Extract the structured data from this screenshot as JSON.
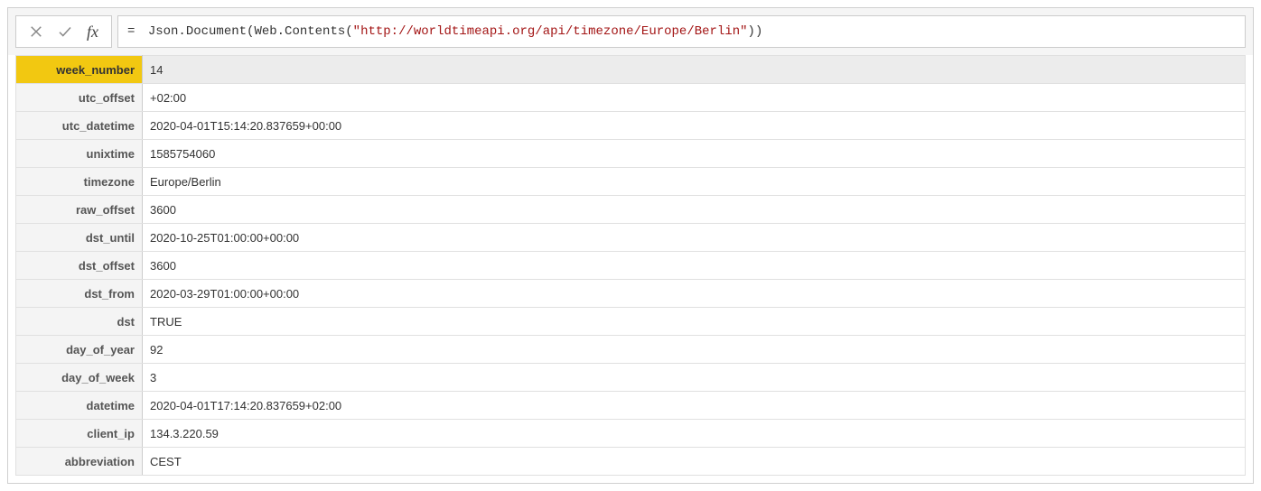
{
  "formula": {
    "prefix": "= ",
    "fn1": "Json.Document",
    "fn2": "Web.Contents",
    "url": "\"http://worldtimeapi.org/api/timezone/Europe/Berlin\""
  },
  "rows": [
    {
      "key": "week_number",
      "value": "14",
      "selected": true
    },
    {
      "key": "utc_offset",
      "value": "+02:00"
    },
    {
      "key": "utc_datetime",
      "value": "2020-04-01T15:14:20.837659+00:00"
    },
    {
      "key": "unixtime",
      "value": "1585754060"
    },
    {
      "key": "timezone",
      "value": "Europe/Berlin"
    },
    {
      "key": "raw_offset",
      "value": "3600"
    },
    {
      "key": "dst_until",
      "value": "2020-10-25T01:00:00+00:00"
    },
    {
      "key": "dst_offset",
      "value": "3600"
    },
    {
      "key": "dst_from",
      "value": "2020-03-29T01:00:00+00:00"
    },
    {
      "key": "dst",
      "value": "TRUE"
    },
    {
      "key": "day_of_year",
      "value": "92"
    },
    {
      "key": "day_of_week",
      "value": "3"
    },
    {
      "key": "datetime",
      "value": "2020-04-01T17:14:20.837659+02:00"
    },
    {
      "key": "client_ip",
      "value": "134.3.220.59"
    },
    {
      "key": "abbreviation",
      "value": "CEST"
    }
  ],
  "fx_label": "fx"
}
